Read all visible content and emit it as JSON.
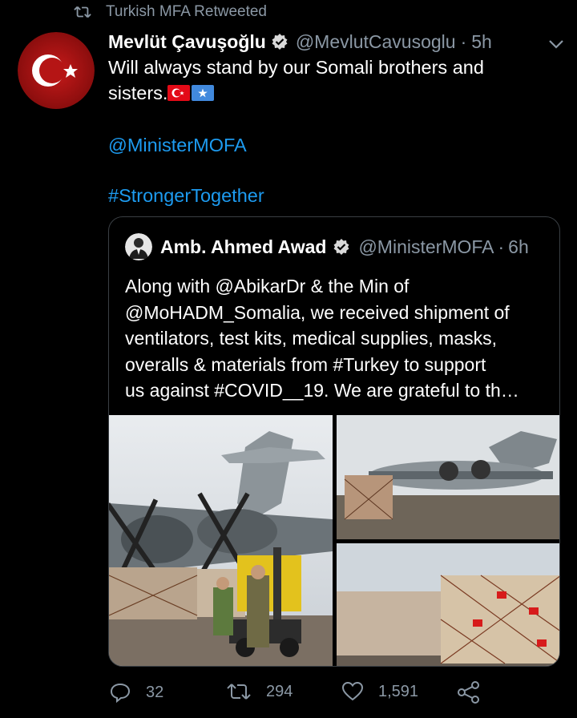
{
  "retweet": {
    "label": "Turkish MFA Retweeted",
    "icon": "retweet-icon"
  },
  "tweet": {
    "author_name": "Mevlüt Çavuşoğlu",
    "handle": "@MevlutCavusoglu",
    "separator": "·",
    "time": "5h",
    "text_line1": "Will always stand by our Somali brothers and",
    "text_line2": "sisters.",
    "mention": "@MinisterMOFA",
    "hashtag": "#StrongerTogether"
  },
  "quote": {
    "author_name": "Amb. Ahmed Awad",
    "handle": "@MinisterMOFA",
    "separator": "·",
    "time": "6h",
    "lines": [
      "Along with @AbikarDr & the Min of",
      "@MoHADM_Somalia, we received shipment of",
      "ventilators, test kits, medical supplies, masks,",
      "overalls & materials from #Turkey to support",
      "us against #COVID__19. We are grateful to th…"
    ]
  },
  "actions": {
    "reply_count": "32",
    "retweet_count": "294",
    "like_count": "1,591"
  },
  "colors": {
    "background": "#000000",
    "link": "#1d9bf0",
    "muted": "#8b98a5",
    "verified": "#d9d9d9"
  }
}
